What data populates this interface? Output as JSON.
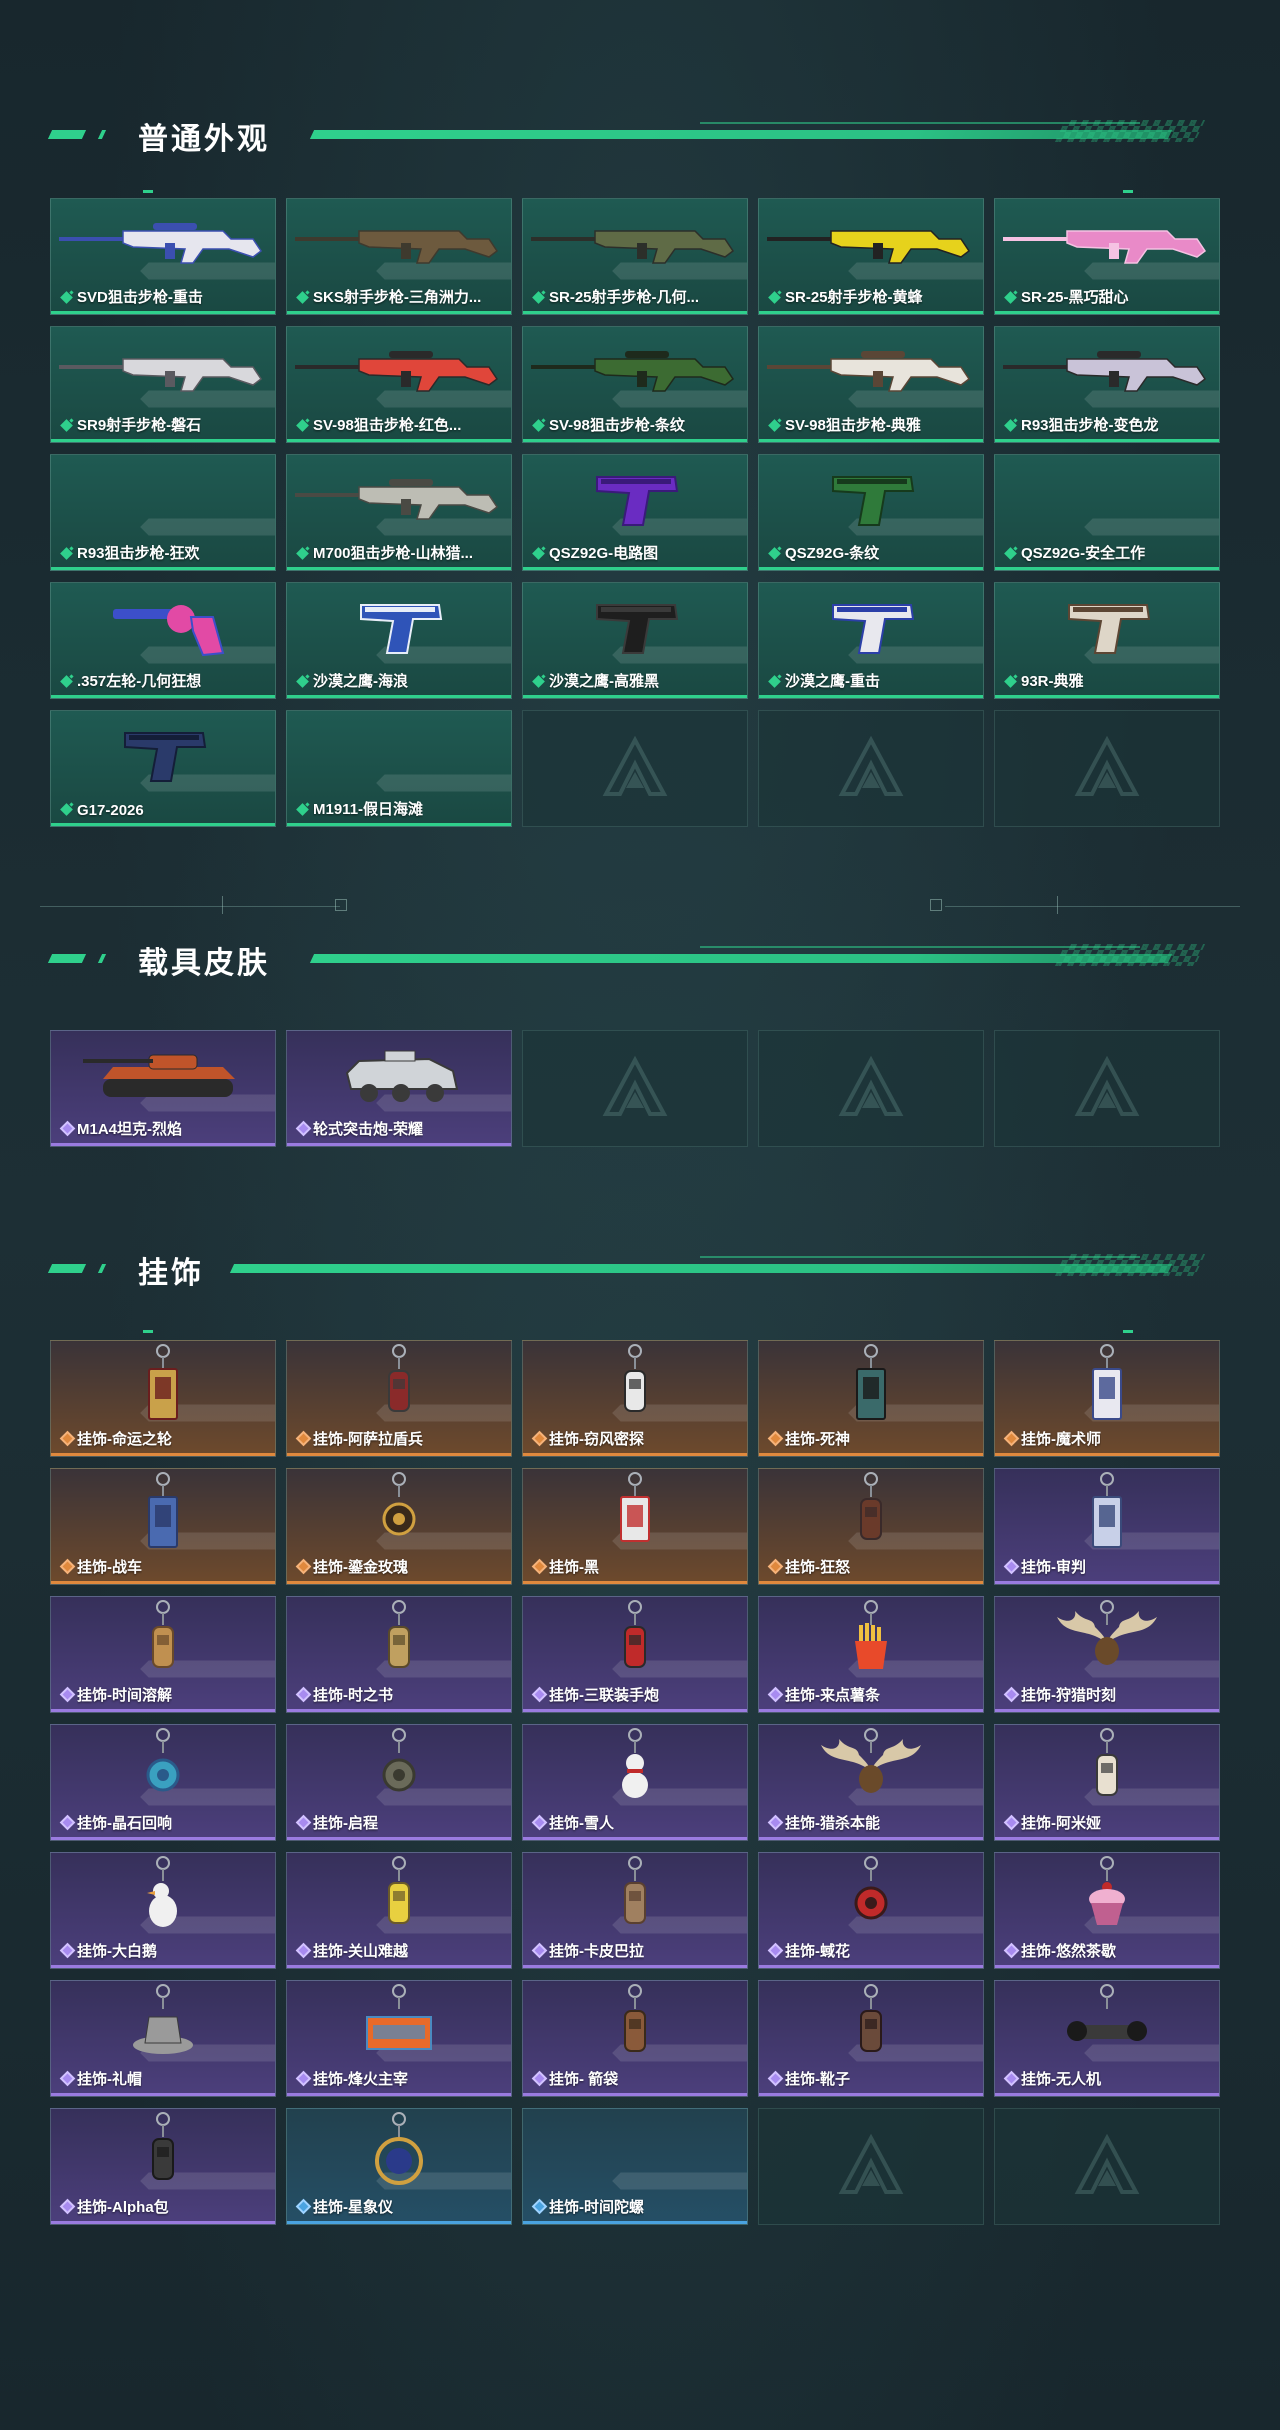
{
  "sections": {
    "appearance": {
      "title": "普通外观"
    },
    "vehicle": {
      "title": "载具皮肤"
    },
    "pendant": {
      "title": "挂饰"
    }
  },
  "appearance_items": [
    {
      "label": "SVD狙击步枪-重击",
      "rarity": "green",
      "icon": "sniper-rifle-icon",
      "colors": [
        "#e6e6ee",
        "#3b4fb0"
      ]
    },
    {
      "label": "SKS射手步枪-三角洲力...",
      "rarity": "green",
      "icon": "rifle-icon",
      "colors": [
        "#6d5a3e",
        "#3e3a2e"
      ]
    },
    {
      "label": "SR-25射手步枪-几何...",
      "rarity": "green",
      "icon": "rifle-icon",
      "colors": [
        "#5f6b46",
        "#2c2f2a"
      ]
    },
    {
      "label": "SR-25射手步枪-黄蜂",
      "rarity": "green",
      "icon": "rifle-icon",
      "colors": [
        "#e6d21c",
        "#222222"
      ]
    },
    {
      "label": "SR-25-黑巧甜心",
      "rarity": "green",
      "icon": "rifle-icon",
      "colors": [
        "#e98ac8",
        "#f5c2e3"
      ]
    },
    {
      "label": "SR9射手步枪-磐石",
      "rarity": "green",
      "icon": "rifle-icon",
      "colors": [
        "#d8d8dc",
        "#5a5a60"
      ]
    },
    {
      "label": "SV-98狙击步枪-红色...",
      "rarity": "green",
      "icon": "sniper-rifle-icon",
      "colors": [
        "#e0463a",
        "#2a2a2a"
      ]
    },
    {
      "label": "SV-98狙击步枪-条纹",
      "rarity": "green",
      "icon": "sniper-rifle-icon",
      "colors": [
        "#3c6b32",
        "#1e2a1c"
      ]
    },
    {
      "label": "SV-98狙击步枪-典雅",
      "rarity": "green",
      "icon": "sniper-rifle-icon",
      "colors": [
        "#e8e4dc",
        "#5a4636"
      ]
    },
    {
      "label": "R93狙击步枪-变色龙",
      "rarity": "green",
      "icon": "sniper-rifle-icon",
      "colors": [
        "#c9c3d8",
        "#2a2a2a"
      ]
    },
    {
      "label": "R93狙击步枪-狂欢",
      "rarity": "green",
      "icon": "none",
      "colors": [
        "#1f5a52",
        "#1f5a52"
      ]
    },
    {
      "label": "M700狙击步枪-山林猎...",
      "rarity": "green",
      "icon": "sniper-rifle-icon",
      "colors": [
        "#bdbdb4",
        "#4a4a44"
      ]
    },
    {
      "label": "QSZ92G-电路图",
      "rarity": "green",
      "icon": "pistol-icon",
      "colors": [
        "#6a2cc2",
        "#3a1a7a"
      ]
    },
    {
      "label": "QSZ92G-条纹",
      "rarity": "green",
      "icon": "pistol-icon",
      "colors": [
        "#2f7a3a",
        "#163a1c"
      ]
    },
    {
      "label": "QSZ92G-安全工作",
      "rarity": "green",
      "icon": "none",
      "colors": [
        "#1f5a52",
        "#1f5a52"
      ]
    },
    {
      "label": ".357左轮-几何狂想",
      "rarity": "green",
      "icon": "revolver-icon",
      "colors": [
        "#e24aa5",
        "#3c4fc9"
      ]
    },
    {
      "label": "沙漠之鹰-海浪",
      "rarity": "green",
      "icon": "pistol-icon",
      "colors": [
        "#2f54b8",
        "#e8eef8"
      ]
    },
    {
      "label": "沙漠之鹰-高雅黑",
      "rarity": "green",
      "icon": "pistol-icon",
      "colors": [
        "#1e1e1e",
        "#3a3a3a"
      ]
    },
    {
      "label": "沙漠之鹰-重击",
      "rarity": "green",
      "icon": "pistol-icon",
      "colors": [
        "#e8e8ee",
        "#2b3fa8"
      ]
    },
    {
      "label": "93R-典雅",
      "rarity": "green",
      "icon": "pistol-icon",
      "colors": [
        "#ded6c8",
        "#5c4634"
      ]
    },
    {
      "label": "G17-2026",
      "rarity": "green",
      "icon": "pistol-icon",
      "colors": [
        "#2a3a6a",
        "#141e38"
      ]
    },
    {
      "label": "M1911-假日海滩",
      "rarity": "green",
      "icon": "none",
      "colors": [
        "#1f5a52",
        "#1f5a52"
      ]
    }
  ],
  "vehicle_items": [
    {
      "label": "M1A4坦克-烈焰",
      "rarity": "purple",
      "icon": "tank-icon",
      "colors": [
        "#c0542a",
        "#2a2a2a"
      ]
    },
    {
      "label": "轮式突击炮-荣耀",
      "rarity": "purple",
      "icon": "armored-car-icon",
      "colors": [
        "#d0d4d8",
        "#3a3a3a"
      ]
    }
  ],
  "pendant_items": [
    {
      "label": "挂饰-命运之轮",
      "rarity": "orange",
      "icon": "card-charm-icon",
      "colors": [
        "#c9a14a",
        "#6a1e1e"
      ]
    },
    {
      "label": "挂饰-阿萨拉盾兵",
      "rarity": "orange",
      "icon": "figure-charm-icon",
      "colors": [
        "#8a2a2a",
        "#3a3a3a"
      ]
    },
    {
      "label": "挂饰-窃风密探",
      "rarity": "orange",
      "icon": "figure-charm-icon",
      "colors": [
        "#e8e8e8",
        "#2a2a2a"
      ]
    },
    {
      "label": "挂饰-死神",
      "rarity": "orange",
      "icon": "card-charm-icon",
      "colors": [
        "#3a6a6a",
        "#1a1a1a"
      ]
    },
    {
      "label": "挂饰-魔术师",
      "rarity": "orange",
      "icon": "card-charm-icon",
      "colors": [
        "#e8e8f0",
        "#3a4a8a"
      ]
    },
    {
      "label": "挂饰-战车",
      "rarity": "orange",
      "icon": "card-charm-icon",
      "colors": [
        "#4a6ab0",
        "#2a3a6a"
      ]
    },
    {
      "label": "挂饰-鎏金玫瑰",
      "rarity": "orange",
      "icon": "round-charm-icon",
      "colors": [
        "#3a2a1a",
        "#d0a040"
      ]
    },
    {
      "label": "挂饰-黑",
      "rarity": "orange",
      "icon": "tag-charm-icon",
      "colors": [
        "#e8e8e8",
        "#c03030"
      ]
    },
    {
      "label": "挂饰-狂怒",
      "rarity": "orange",
      "icon": "chain-charm-icon",
      "colors": [
        "#6a3a2a",
        "#3a2a2a"
      ]
    },
    {
      "label": "挂饰-审判",
      "rarity": "purple",
      "icon": "card-charm-icon",
      "colors": [
        "#c8d0e8",
        "#3a4a7a"
      ]
    },
    {
      "label": "挂饰-时间溶解",
      "rarity": "purple",
      "icon": "chain-charm-icon",
      "colors": [
        "#c09050",
        "#6a4a2a"
      ]
    },
    {
      "label": "挂饰-时之书",
      "rarity": "purple",
      "icon": "book-charm-icon",
      "colors": [
        "#c0a060",
        "#5a4a2a"
      ]
    },
    {
      "label": "挂饰-三联装手炮",
      "rarity": "purple",
      "icon": "cannon-charm-icon",
      "colors": [
        "#c02a2a",
        "#2a2a2a"
      ]
    },
    {
      "label": "挂饰-来点薯条",
      "rarity": "purple",
      "icon": "fries-charm-icon",
      "colors": [
        "#e84a2a",
        "#f0c040"
      ]
    },
    {
      "label": "挂饰-狩猎时刻",
      "rarity": "purple",
      "icon": "antler-charm-icon",
      "colors": [
        "#d8c8a8",
        "#6a4a2a"
      ]
    },
    {
      "label": "挂饰-晶石回响",
      "rarity": "purple",
      "icon": "crystal-charm-icon",
      "colors": [
        "#3aa0c0",
        "#2a5a8a"
      ]
    },
    {
      "label": "挂饰-启程",
      "rarity": "purple",
      "icon": "round-charm-icon",
      "colors": [
        "#6a6a5a",
        "#3a3a30"
      ]
    },
    {
      "label": "挂饰-雪人",
      "rarity": "purple",
      "icon": "snowman-charm-icon",
      "colors": [
        "#f0f0f0",
        "#c02a2a"
      ]
    },
    {
      "label": "挂饰-猎杀本能",
      "rarity": "purple",
      "icon": "antler-charm-icon",
      "colors": [
        "#d8c8a8",
        "#6a4a2a"
      ]
    },
    {
      "label": "挂饰-阿米娅",
      "rarity": "purple",
      "icon": "figure-charm-icon",
      "colors": [
        "#e8e0d0",
        "#3a3a3a"
      ]
    },
    {
      "label": "挂饰-大白鹅",
      "rarity": "purple",
      "icon": "goose-charm-icon",
      "colors": [
        "#f0f0f0",
        "#e8a040"
      ]
    },
    {
      "label": "挂饰-关山难越",
      "rarity": "purple",
      "icon": "capsule-charm-icon",
      "colors": [
        "#e8d040",
        "#6a5a2a"
      ]
    },
    {
      "label": "挂饰-卡皮巴拉",
      "rarity": "purple",
      "icon": "capybara-charm-icon",
      "colors": [
        "#a08060",
        "#5a4030"
      ]
    },
    {
      "label": "挂饰-蜮花",
      "rarity": "purple",
      "icon": "flower-charm-icon",
      "colors": [
        "#c02a2a",
        "#3a1a1a"
      ]
    },
    {
      "label": "挂饰-悠然茶歇",
      "rarity": "purple",
      "icon": "cupcake-charm-icon",
      "colors": [
        "#f0b0d0",
        "#c06090"
      ]
    },
    {
      "label": "挂饰-礼帽",
      "rarity": "purple",
      "icon": "hat-charm-icon",
      "colors": [
        "#9a9a9a",
        "#3a3a3a"
      ]
    },
    {
      "label": "挂饰-烽火主宰",
      "rarity": "purple",
      "icon": "container-charm-icon",
      "colors": [
        "#e86a2a",
        "#4a8ac0"
      ]
    },
    {
      "label": "挂饰- 箭袋",
      "rarity": "purple",
      "icon": "quiver-charm-icon",
      "colors": [
        "#8a5a3a",
        "#3a2a1a"
      ]
    },
    {
      "label": "挂饰-靴子",
      "rarity": "purple",
      "icon": "boot-charm-icon",
      "colors": [
        "#6a4a3a",
        "#2a1a1a"
      ]
    },
    {
      "label": "挂饰-无人机",
      "rarity": "purple",
      "icon": "drone-charm-icon",
      "colors": [
        "#3a3a3a",
        "#1a1a1a"
      ]
    },
    {
      "label": "挂饰-Alpha包",
      "rarity": "purple",
      "icon": "bag-charm-icon",
      "colors": [
        "#3a3a3a",
        "#1a1a1a"
      ]
    },
    {
      "label": "挂饰-星象仪",
      "rarity": "blue",
      "icon": "astrolabe-charm-icon",
      "colors": [
        "#d0a040",
        "#2a3a8a"
      ]
    },
    {
      "label": "挂饰-时间陀螺",
      "rarity": "blue",
      "icon": "none",
      "colors": [
        "#254f66",
        "#254f66"
      ]
    }
  ]
}
